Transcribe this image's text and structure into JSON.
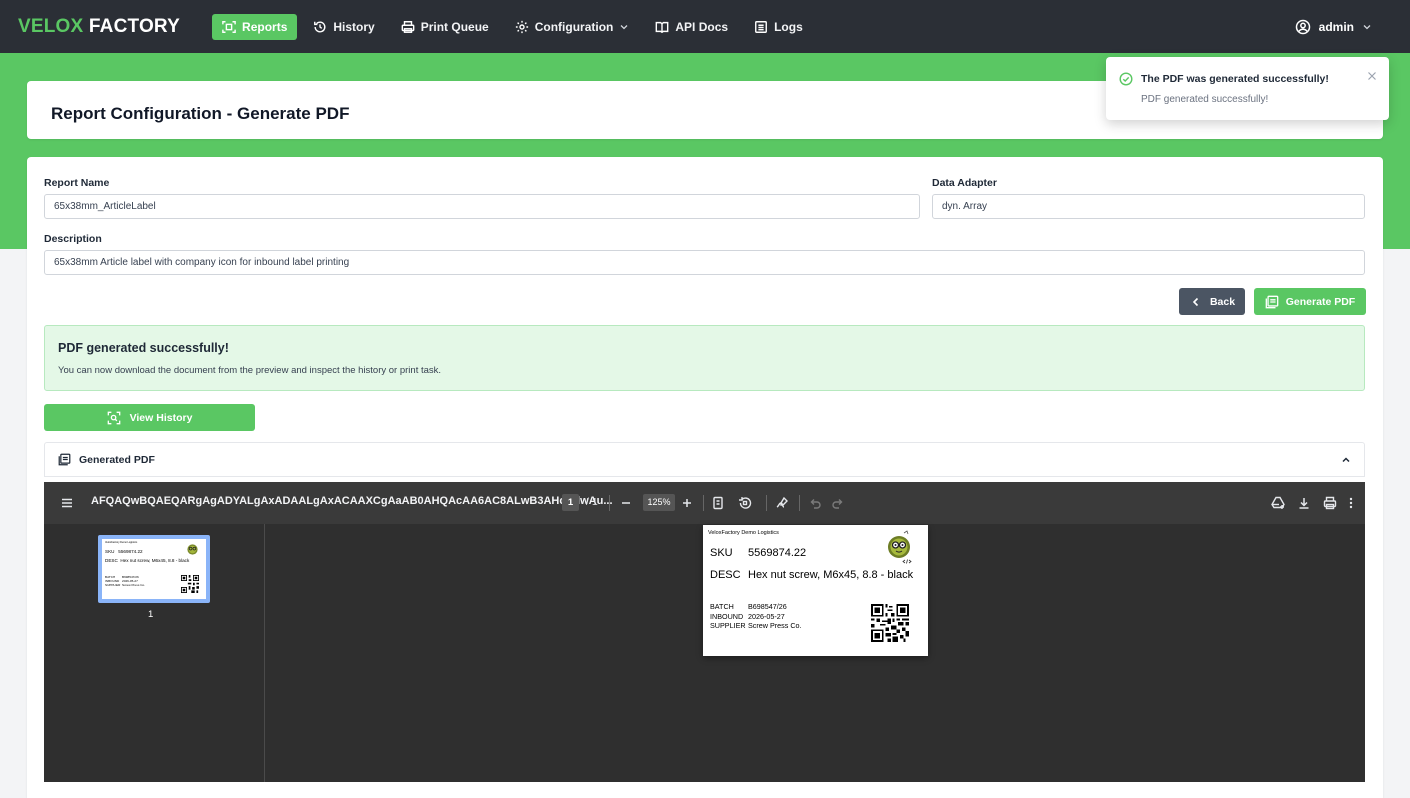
{
  "app": {
    "logo_part1": "VELOX",
    "logo_part2": "FACTORY"
  },
  "nav": {
    "items": [
      {
        "label": "Reports",
        "icon": "reports-icon",
        "active": true
      },
      {
        "label": "History",
        "icon": "history-icon"
      },
      {
        "label": "Print Queue",
        "icon": "printer-icon"
      },
      {
        "label": "Configuration",
        "icon": "gear-icon"
      },
      {
        "label": "API Docs",
        "icon": "book-icon"
      },
      {
        "label": "Logs",
        "icon": "list-icon"
      }
    ],
    "user": "admin"
  },
  "header": {
    "title": "Report Configuration - Generate PDF"
  },
  "toast": {
    "title": "The PDF was generated successfully!",
    "message": "PDF generated successfully!"
  },
  "form": {
    "report_name_label": "Report Name",
    "report_name_value": "65x38mm_ArticleLabel",
    "data_adapter_label": "Data Adapter",
    "data_adapter_value": "dyn. Array",
    "description_label": "Description",
    "description_value": "65x38mm Article label with company icon for inbound label printing"
  },
  "actions": {
    "back_label": "Back",
    "generate_label": "Generate PDF",
    "view_history_label": "View History"
  },
  "alert": {
    "title": "PDF generated successfully!",
    "text": "You can now download the document from the preview and inspect the history or print task."
  },
  "accordion": {
    "title": "Generated PDF"
  },
  "viewer": {
    "document_name": "AFQAQwBQAEQARgAgADYALgAxADAALgAxACAAXCgAaAB0AHQAcAA6AC8ALwB3AHcAdwAu...",
    "current_page": "1",
    "total_pages": "/ 1",
    "zoom": "125%",
    "thumbnail_page_number": "1"
  },
  "label": {
    "company": "VeloxFactory Demo Logistics",
    "sku_key": "SKU",
    "sku_value": "5569874.22",
    "desc_key": "DESC",
    "desc_value": "Hex nut screw, M6x45, 8.8 - black",
    "batch_key": "BATCH",
    "batch_value": "B698547/26",
    "inbound_key": "INBOUND",
    "inbound_value": "2026-05-27",
    "supplier_key": "SUPPLIER",
    "supplier_value": "Screw Press Co."
  },
  "colors": {
    "brand_green": "#5ac763",
    "nav_dark": "#2b2f36",
    "back_gray": "#4b5563",
    "alert_bg": "#e4f8e7",
    "viewer_dark": "#2f2f2f"
  }
}
